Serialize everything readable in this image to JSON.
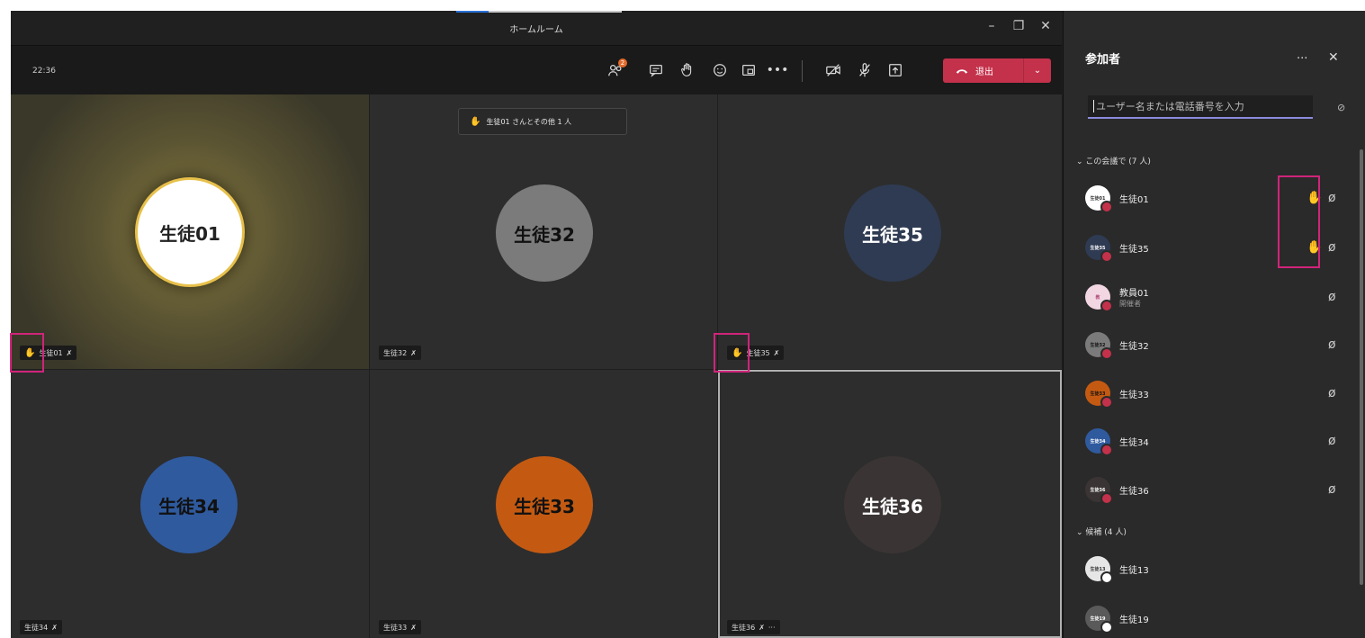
{
  "window": {
    "title": "ホームルーム",
    "min": "–",
    "max": "❐",
    "close": "✕"
  },
  "toolbar": {
    "clock": "22:36",
    "participants_badge": "2",
    "more": "•••",
    "leave_label": "退出"
  },
  "notification": {
    "text": "生徒01 さんとその他 1 人"
  },
  "tiles": [
    {
      "avatar_text": "生徒01",
      "avatar_color": "#ffffff",
      "text_color": "#222222",
      "tag": "生徒01"
    },
    {
      "avatar_text": "生徒32",
      "avatar_color": "#7b7b7b",
      "text_color": "#111111",
      "tag": "生徒32"
    },
    {
      "avatar_text": "生徒35",
      "avatar_color": "#2f3b52",
      "text_color": "#ffffff",
      "tag": "生徒35"
    },
    {
      "avatar_text": "生徒34",
      "avatar_color": "#2f5a9e",
      "text_color": "#111111",
      "tag": "生徒34"
    },
    {
      "avatar_text": "生徒33",
      "avatar_color": "#c45a12",
      "text_color": "#111111",
      "tag": "生徒33"
    },
    {
      "avatar_text": "生徒36",
      "avatar_color": "#3a3534",
      "text_color": "#ffffff",
      "tag": "生徒36",
      "extra": "···"
    }
  ],
  "panel": {
    "title": "参加者",
    "more": "···",
    "close": "✕",
    "search_placeholder": "ユーザー名または電話番号を入力",
    "section_meeting": "この会議で (7 人)",
    "section_suggested": "候補 (4 人)",
    "participants": [
      {
        "name": "生徒01",
        "av": "#ffffff",
        "avtext": "生徒01",
        "avfg": "#333333",
        "status": "#c4314b",
        "hand": true,
        "mic": true
      },
      {
        "name": "生徒35",
        "av": "#2f3b52",
        "avtext": "生徒35",
        "avfg": "#ffffff",
        "status": "#c4314b",
        "hand": true,
        "mic": true
      },
      {
        "name": "教員01",
        "role": "開催者",
        "av": "#f2d7e3",
        "avtext": "教",
        "avfg": "#b04b78",
        "status": "#c4314b",
        "hand": false,
        "mic": true
      },
      {
        "name": "生徒32",
        "av": "#7b7b7b",
        "avtext": "生徒32",
        "avfg": "#111111",
        "status": "#c4314b",
        "hand": false,
        "mic": true
      },
      {
        "name": "生徒33",
        "av": "#c45a12",
        "avtext": "生徒33",
        "avfg": "#111111",
        "status": "#c4314b",
        "hand": false,
        "mic": true
      },
      {
        "name": "生徒34",
        "av": "#2f5a9e",
        "avtext": "生徒34",
        "avfg": "#ffffff",
        "status": "#c4314b",
        "hand": false,
        "mic": true
      },
      {
        "name": "生徒36",
        "av": "#3a3534",
        "avtext": "生徒36",
        "avfg": "#ffffff",
        "status": "#c4314b",
        "hand": false,
        "mic": true
      }
    ],
    "suggested": [
      {
        "name": "生徒13",
        "av": "#e6e6e6",
        "avtext": "生徒13",
        "avfg": "#333333",
        "status": "#ffffff"
      },
      {
        "name": "生徒19",
        "av": "#5a5a5a",
        "avtext": "生徒19",
        "avfg": "#ffffff",
        "status": "#ffffff"
      }
    ]
  },
  "icons": {
    "hand": "✋",
    "mic_off": "🎙̸",
    "raise_hand": "hand-icon"
  }
}
